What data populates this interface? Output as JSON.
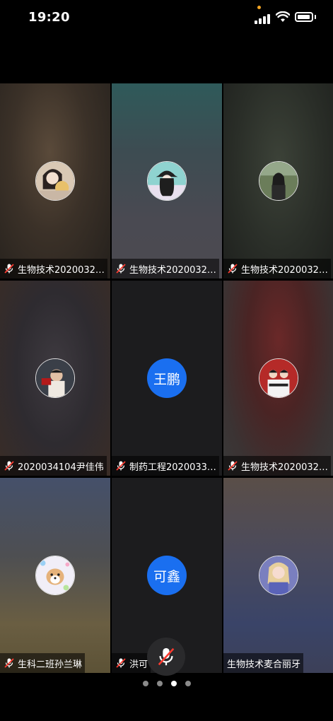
{
  "status_bar": {
    "time": "19:20"
  },
  "participants": [
    {
      "name": "生物技术2020032…",
      "avatar": "photo-girl-with-flower"
    },
    {
      "name": "生物技术2020032…",
      "avatar": "cartoon-girl-hat"
    },
    {
      "name": "生物技术2020032…",
      "avatar": "photo-girl-outdoor"
    },
    {
      "name": "2020034104尹佳伟",
      "avatar": "photo-child"
    },
    {
      "name": "制药工程2020033…",
      "avatar_text": "王鹏"
    },
    {
      "name": "生物技术2020032…",
      "avatar": "photo-couple-red"
    },
    {
      "name": "生科二班孙兰琳",
      "avatar": "cartoon-dog"
    },
    {
      "name": "洪可",
      "avatar_text": "可鑫"
    },
    {
      "name": "生物技术麦合丽牙",
      "avatar": "photo-girl-purple"
    }
  ],
  "pager": {
    "total": 4,
    "active": 2
  },
  "colors": {
    "text_avatar_bg": "#1a6ff0",
    "mute_icon_red": "#ff3b30"
  }
}
